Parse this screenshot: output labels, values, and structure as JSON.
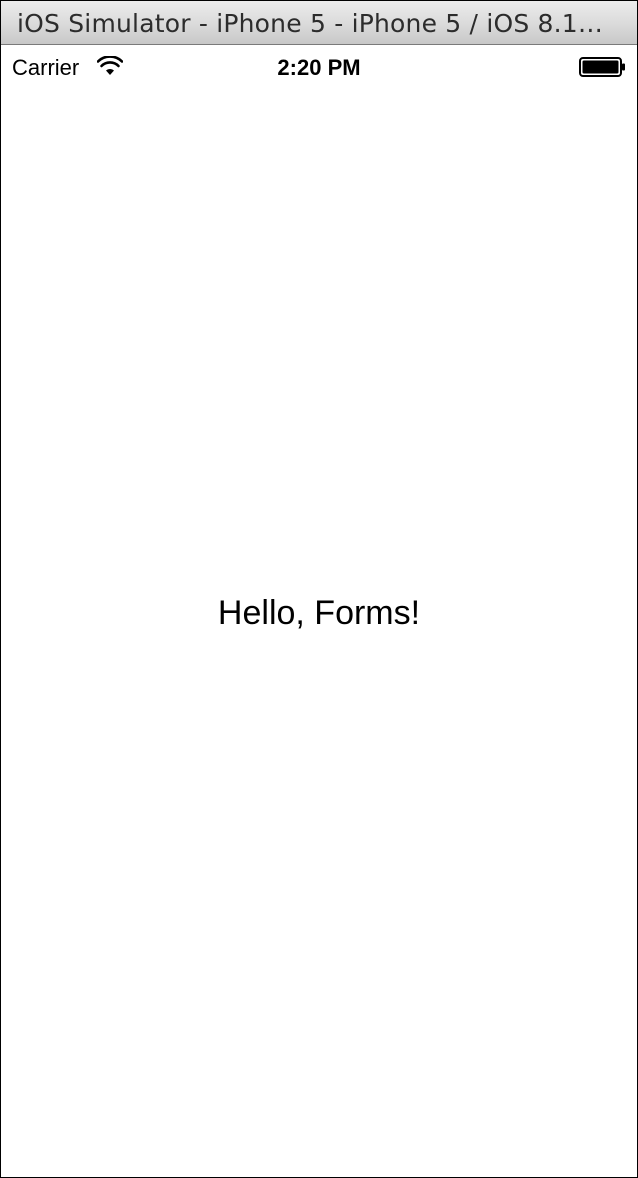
{
  "window": {
    "title": "iOS Simulator - iPhone 5 - iPhone 5 / iOS 8.1…"
  },
  "status_bar": {
    "carrier": "Carrier",
    "time": "2:20 PM",
    "icons": [
      "wifi-icon",
      "battery-icon"
    ]
  },
  "main": {
    "label": "Hello, Forms!"
  }
}
